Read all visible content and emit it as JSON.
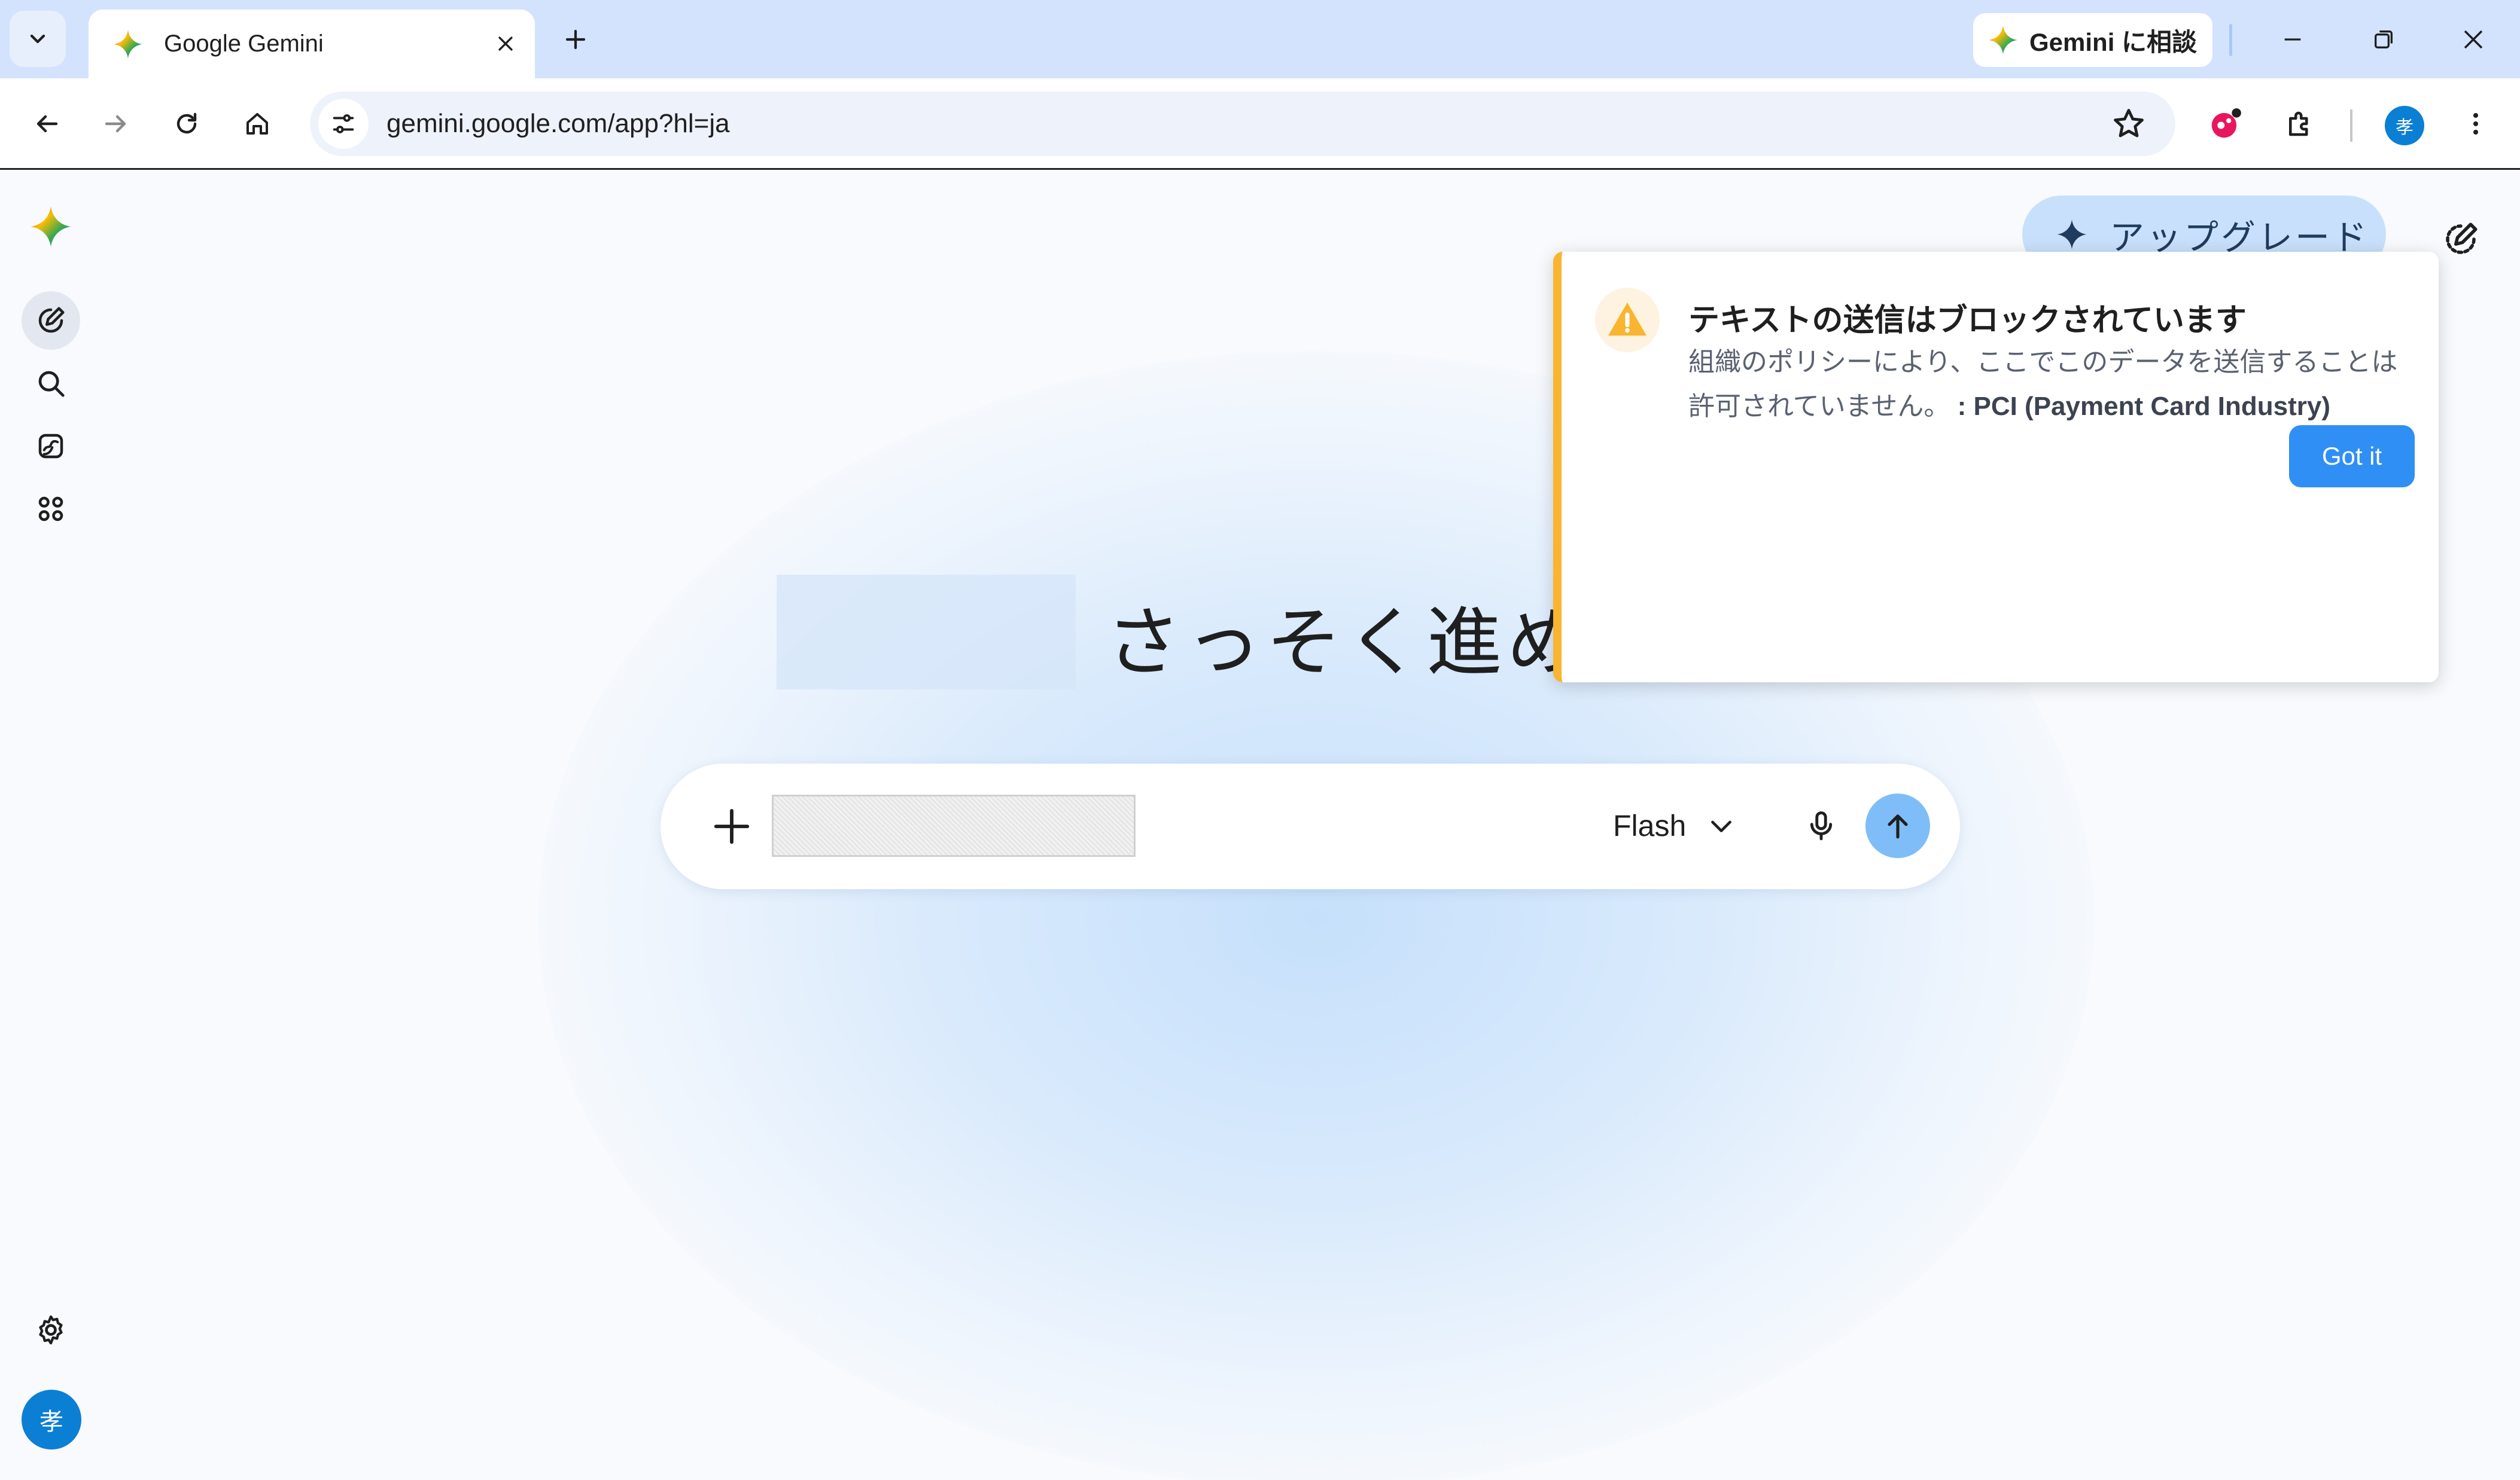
{
  "browser": {
    "tab": {
      "title": "Google Gemini"
    },
    "gemini_chip": {
      "label": "Gemini に相談"
    },
    "address": {
      "url": "gemini.google.com/app?hl=ja"
    },
    "profile_initial": "孝"
  },
  "app": {
    "upgrade_label": "アップグレード",
    "hero_text": "さっそく進めましょう",
    "prompt": {
      "model_label": "Flash"
    },
    "avatar_initial": "孝"
  },
  "toast": {
    "title": "テキストの送信はブロックされています",
    "body": "組織のポリシーにより、ここでこのデータを送信することは許可されていません。",
    "policy": ": PCI (Payment Card Industry)",
    "button_label": "Got it"
  },
  "colors": {
    "accent": "#2f8ff5",
    "warning": "#f9b530",
    "tabstrip": "#d3e3fd",
    "avatar": "#0b7fd4"
  }
}
